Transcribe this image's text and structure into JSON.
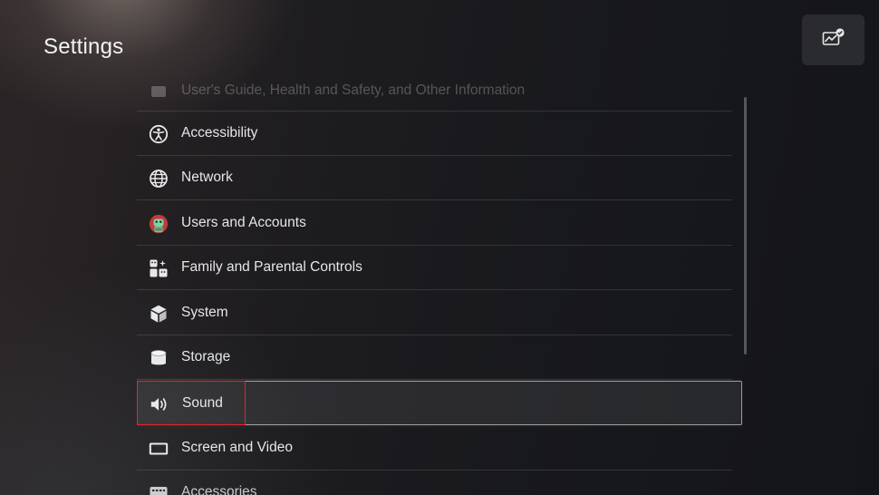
{
  "header": {
    "title": "Settings",
    "top_right_icon": "performance-check-icon"
  },
  "menu": {
    "items": [
      {
        "label": "User's Guide, Health and Safety, and Other Information",
        "icon": "guide-icon"
      },
      {
        "label": "Accessibility",
        "icon": "accessibility-icon"
      },
      {
        "label": "Network",
        "icon": "globe-icon"
      },
      {
        "label": "Users and Accounts",
        "icon": "avatar-icon"
      },
      {
        "label": "Family and Parental Controls",
        "icon": "family-icon"
      },
      {
        "label": "System",
        "icon": "cube-icon"
      },
      {
        "label": "Storage",
        "icon": "cylinder-icon"
      },
      {
        "label": "Sound",
        "icon": "speaker-icon"
      },
      {
        "label": "Screen and Video",
        "icon": "screen-icon"
      },
      {
        "label": "Accessories",
        "icon": "keyboard-icon"
      }
    ],
    "selected_label": "Sound"
  },
  "colors": {
    "highlight": "#e3262c",
    "background": "#1b1b1f"
  }
}
